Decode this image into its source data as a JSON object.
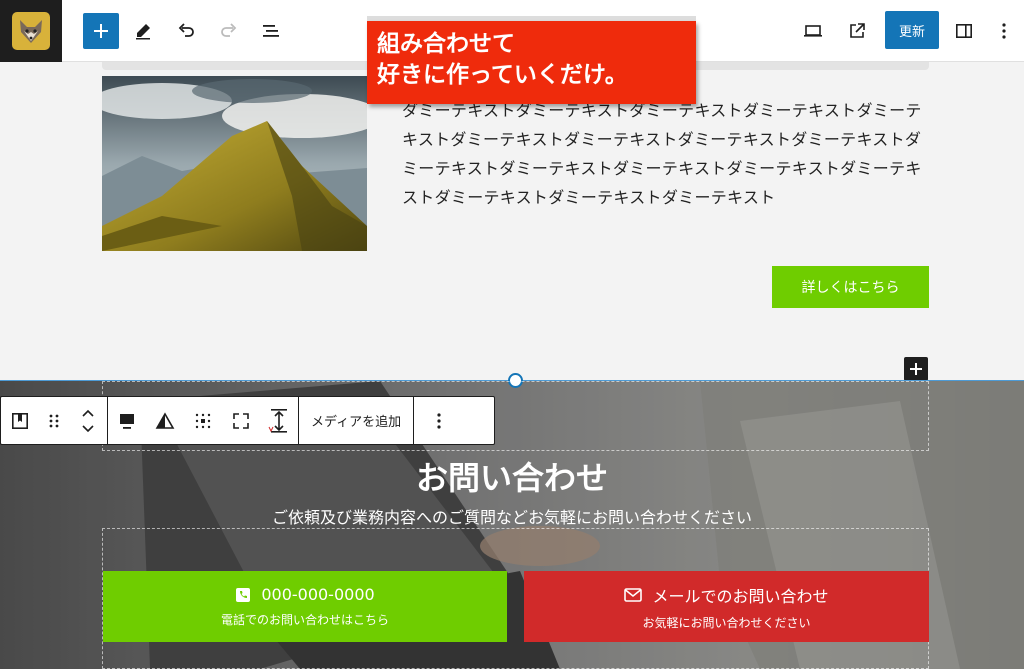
{
  "toolbar": {
    "update_label": "更新"
  },
  "annotation": {
    "line1": "組み合わせて",
    "line2": "好きに作っていくだけ。"
  },
  "content": {
    "body_text": "ダミーテキストダミーテキストダミーテキストダミーテキストダミーテキストダミーテキストダミーテキストダミーテキストダミーテキストダミーテキストダミーテキストダミーテキストダミーテキストダミーテキストダミーテキストダミーテキストダミーテキスト",
    "detail_button": "詳しくはこちら"
  },
  "block_toolbar": {
    "add_media_label": "メディアを追加"
  },
  "cover": {
    "title": "お問い合わせ",
    "subtitle": "ご依頼及び業務内容へのご質問などお気軽にお問い合わせください",
    "phone_main": "000-000-0000",
    "phone_sub": "電話でのお問い合わせはこちら",
    "mail_main": "メールでのお問い合わせ",
    "mail_sub": "お気軽にお問い合わせください"
  },
  "colors": {
    "accent_blue": "#1475b7",
    "green": "#6fcd00",
    "red": "#d12a2a",
    "annotation_red": "#ef2b0c"
  },
  "icons": [
    "fox-logo-icon",
    "plus-icon",
    "pen-icon",
    "undo-icon",
    "redo-icon",
    "list-view-icon",
    "desktop-preview-icon",
    "external-link-icon",
    "sidebar-toggle-icon",
    "more-vertical-icon",
    "cover-block-icon",
    "drag-handle-icon",
    "move-up-down-icon",
    "align-icon",
    "contrast-icon",
    "grid-position-icon",
    "fullscreen-icon",
    "height-icon",
    "phone-icon",
    "mail-icon"
  ]
}
